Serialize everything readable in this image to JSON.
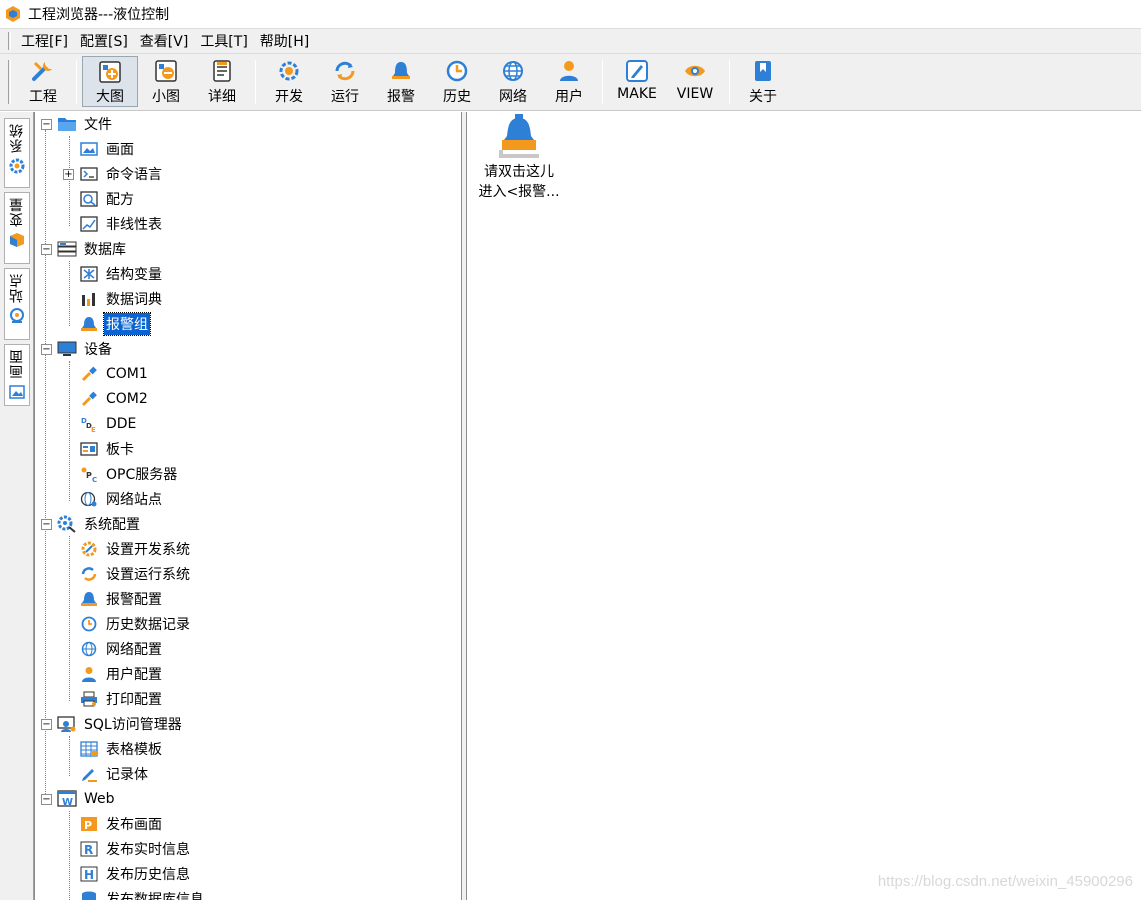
{
  "window": {
    "title": "工程浏览器---液位控制"
  },
  "menu": [
    "工程[F]",
    "配置[S]",
    "查看[V]",
    "工具[T]",
    "帮助[H]"
  ],
  "toolbar": {
    "project": "工程",
    "large": "大图",
    "small": "小图",
    "detail": "详细",
    "develop": "开发",
    "run": "运行",
    "alarm": "报警",
    "history": "历史",
    "network": "网络",
    "user": "用户",
    "make": "MAKE",
    "view": "VIEW",
    "about": "关于"
  },
  "side_tabs": [
    "系统",
    "变量",
    "站点",
    "画面"
  ],
  "tree": {
    "file": "文件",
    "screen": "画面",
    "command_language": "命令语言",
    "recipe": "配方",
    "nonlinear_table": "非线性表",
    "database": "数据库",
    "struct_variable": "结构变量",
    "data_dictionary": "数据词典",
    "alarm_group": "报警组",
    "device": "设备",
    "com1": "COM1",
    "com2": "COM2",
    "dde": "DDE",
    "board": "板卡",
    "opc_server": "OPC服务器",
    "network_station": "网络站点",
    "system_config": "系统配置",
    "set_dev_system": "设置开发系统",
    "set_run_system": "设置运行系统",
    "alarm_config": "报警配置",
    "history_record": "历史数据记录",
    "network_config": "网络配置",
    "user_config": "用户配置",
    "print_config": "打印配置",
    "sql_manager": "SQL访问管理器",
    "table_template": "表格模板",
    "record_body": "记录体",
    "web": "Web",
    "publish_screen": "发布画面",
    "publish_realtime": "发布实时信息",
    "publish_history": "发布历史信息",
    "publish_database": "发布数据库信息"
  },
  "content": {
    "item_line1": "请双击这儿",
    "item_line2": "进入<报警..."
  },
  "watermark": "https://blog.csdn.net/weixin_45900296",
  "colors": {
    "selection": "#0a64d2",
    "orange_icon": "#f39a1e",
    "blue_icon": "#2e7fd6"
  }
}
